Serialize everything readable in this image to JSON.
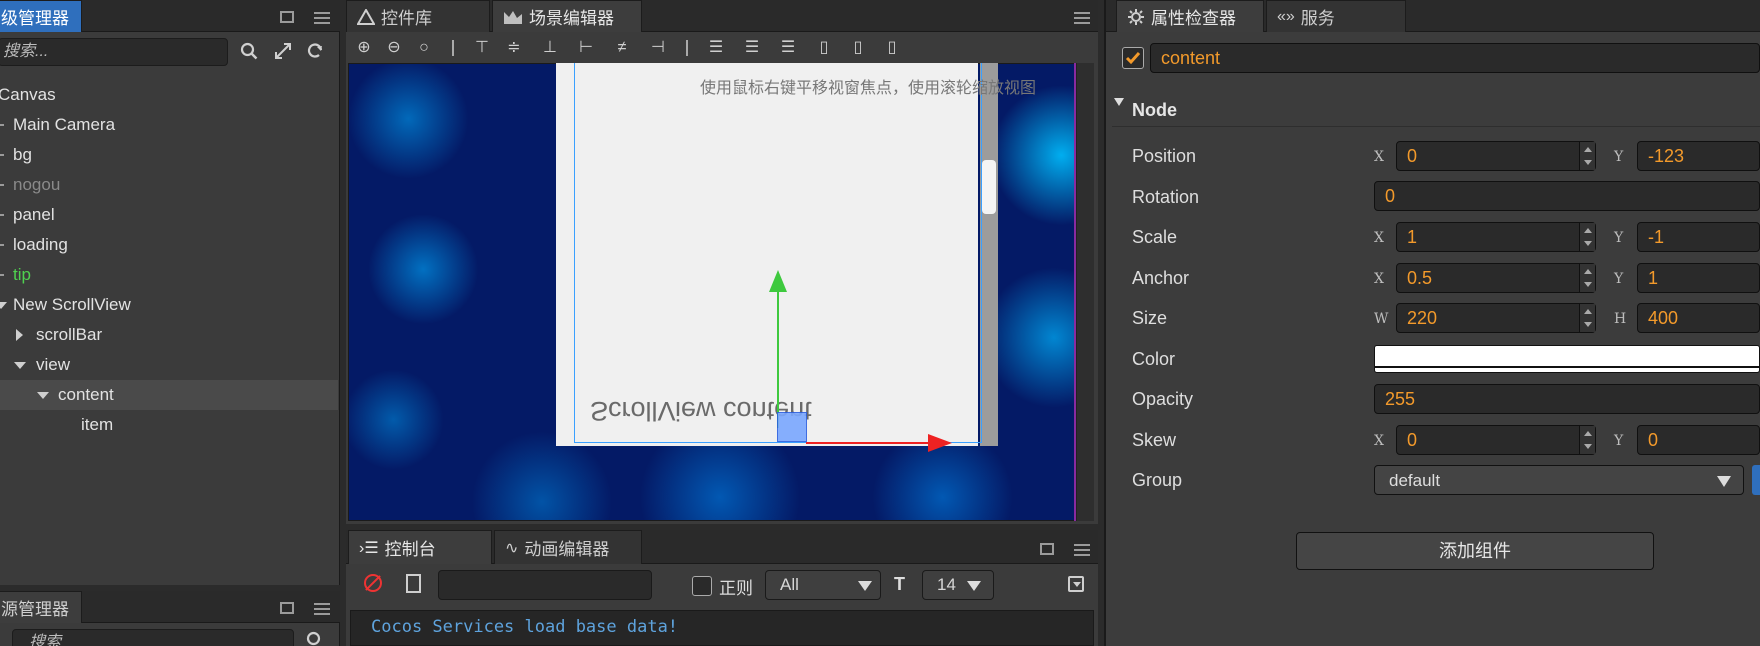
{
  "hierarchy": {
    "tab_label": "级管理器",
    "search_placeholder": "搜索...",
    "items": [
      {
        "label": "Canvas",
        "color": "#e2e2e2"
      },
      {
        "label": "Main Camera",
        "color": "#e2e2e2"
      },
      {
        "label": "bg",
        "color": "#e2e2e2"
      },
      {
        "label": "nogou",
        "color": "#8a8a8a"
      },
      {
        "label": "panel",
        "color": "#e2e2e2"
      },
      {
        "label": "loading",
        "color": "#e2e2e2"
      },
      {
        "label": "tip",
        "color": "#4fd14f"
      },
      {
        "label": "New ScrollView",
        "color": "#e2e2e2"
      },
      {
        "label": "scrollBar",
        "color": "#e2e2e2"
      },
      {
        "label": "view",
        "color": "#e2e2e2"
      },
      {
        "label": "content",
        "color": "#e2e2e2"
      },
      {
        "label": "item",
        "color": "#e2e2e2"
      }
    ]
  },
  "assets": {
    "tab_label": "源管理器",
    "search_placeholder": "搜索"
  },
  "scene": {
    "tabs": [
      {
        "label": "控件库",
        "icon": "widget-library-icon"
      },
      {
        "label": "场景编辑器",
        "icon": "scene-editor-icon"
      }
    ],
    "hint": "使用鼠标右键平移视窗焦点，使用滚轮缩放视图",
    "node_text": "ScrollView content"
  },
  "console": {
    "tabs": [
      {
        "label": "控制台",
        "icon": "console-icon"
      },
      {
        "label": "动画编辑器",
        "icon": "animation-editor-icon"
      }
    ],
    "regex_label": "正则",
    "filter_value": "All",
    "font_size": "14",
    "log_line": "Cocos Services load base data!"
  },
  "inspector": {
    "tabs": [
      {
        "label": "属性检查器",
        "icon": "gear-icon"
      },
      {
        "label": "服务",
        "icon": "services-icon"
      }
    ],
    "node_name": "content",
    "section_title": "Node",
    "position": {
      "label": "Position",
      "x": "0",
      "y": "-123"
    },
    "rotation": {
      "label": "Rotation",
      "value": "0"
    },
    "scale": {
      "label": "Scale",
      "x": "1",
      "y": "-1"
    },
    "anchor": {
      "label": "Anchor",
      "x": "0.5",
      "y": "1"
    },
    "size": {
      "label": "Size",
      "w": "220",
      "h": "400"
    },
    "color": {
      "label": "Color",
      "value": "#ffffff"
    },
    "opacity": {
      "label": "Opacity",
      "value": "255"
    },
    "skew": {
      "label": "Skew",
      "x": "0",
      "y": "0"
    },
    "group": {
      "label": "Group",
      "value": "default"
    },
    "add_component": "添加组件",
    "axis_labels": {
      "x": "X",
      "y": "Y",
      "w": "W",
      "h": "H"
    }
  }
}
